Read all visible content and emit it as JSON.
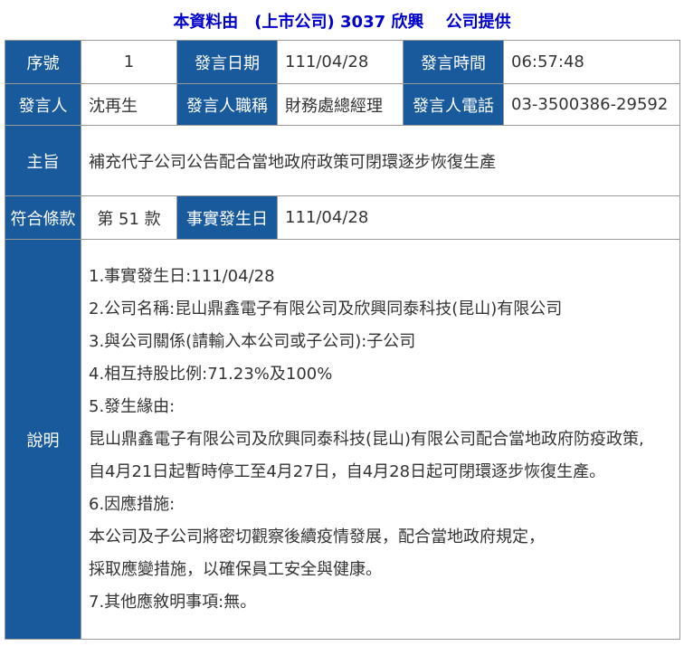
{
  "header": {
    "title": "本資料由　(上市公司) 3037 欣興　 公司提供"
  },
  "row1": {
    "seq_label": "序號",
    "seq_value": "1",
    "date_label": "發言日期",
    "date_value": "111/04/28",
    "time_label": "發言時間",
    "time_value": "06:57:48"
  },
  "row2": {
    "speaker_label": "發言人",
    "speaker_value": "沈再生",
    "title_label": "發言人職稱",
    "title_value": "財務處總經理",
    "phone_label": "發言人電話",
    "phone_value": "03-3500386-29592"
  },
  "subject": {
    "label": "主旨",
    "value": "補充代子公司公告配合當地政府政策可閉環逐步恢復生產"
  },
  "row4": {
    "clause_label": "符合條款",
    "clause_value": "第 51 款",
    "fact_date_label": "事實發生日",
    "fact_date_value": "111/04/28"
  },
  "description": {
    "label": "說明",
    "lines": [
      "1.事實發生日:111/04/28",
      "2.公司名稱:昆山鼎鑫電子有限公司及欣興同泰科技(昆山)有限公司",
      "3.與公司關係(請輸入本公司或子公司):子公司",
      "4.相互持股比例:71.23%及100%",
      "5.發生緣由:",
      "昆山鼎鑫電子有限公司及欣興同泰科技(昆山)有限公司配合當地政府防疫政策,",
      "自4月21日起暫時停工至4月27日，自4月28日起可閉環逐步恢復生產。",
      "6.因應措施:",
      "本公司及子公司將密切觀察後續疫情發展，配合當地政府規定，",
      "採取應變措施，以確保員工安全與健康。",
      "7.其他應敘明事項:無。"
    ]
  },
  "colors": {
    "header_cell_bg": "#195a9c",
    "title_text": "#0000cc",
    "border": "#999999"
  }
}
